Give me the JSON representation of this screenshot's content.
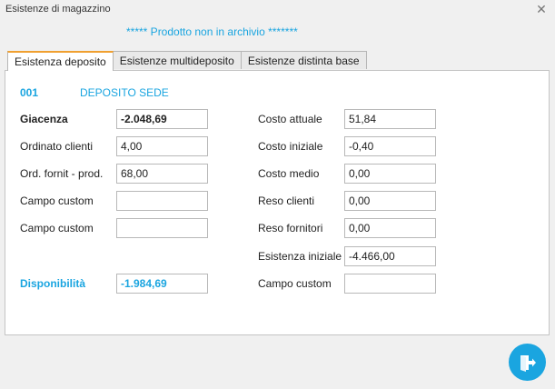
{
  "window": {
    "title": "Esistenze di magazzino",
    "close_glyph": "✕"
  },
  "header": {
    "message": "***** Prodotto non in archivio *******"
  },
  "tabs": [
    {
      "label": "Esistenza deposito",
      "active": true
    },
    {
      "label": "Esistenze multideposito",
      "active": false
    },
    {
      "label": "Esistenze distinta base",
      "active": false
    }
  ],
  "deposit": {
    "code": "001",
    "name": "DEPOSITO SEDE"
  },
  "left_fields": [
    {
      "label": "Giacenza",
      "value": "-2.048,69"
    },
    {
      "label": "Ordinato clienti",
      "value": "4,00"
    },
    {
      "label": "Ord. fornit - prod.",
      "value": "68,00"
    },
    {
      "label": "Campo custom",
      "value": ""
    },
    {
      "label": "Campo custom",
      "value": ""
    },
    {
      "label": "Disponibilità",
      "value": "-1.984,69"
    }
  ],
  "right_fields": [
    {
      "label": "Costo attuale",
      "value": "51,84"
    },
    {
      "label": "Costo iniziale",
      "value": "-0,40"
    },
    {
      "label": "Costo medio",
      "value": "0,00"
    },
    {
      "label": "Reso clienti",
      "value": "0,00"
    },
    {
      "label": "Reso fornitori",
      "value": "0,00"
    },
    {
      "label": "Esistenza iniziale",
      "value": "-4.466,00"
    },
    {
      "label": "Campo custom",
      "value": ""
    }
  ],
  "colors": {
    "accent": "#1aa5e0",
    "tab_highlight": "#f0a030"
  },
  "icons": {
    "exit": "exit-door-icon",
    "close": "close-icon"
  }
}
